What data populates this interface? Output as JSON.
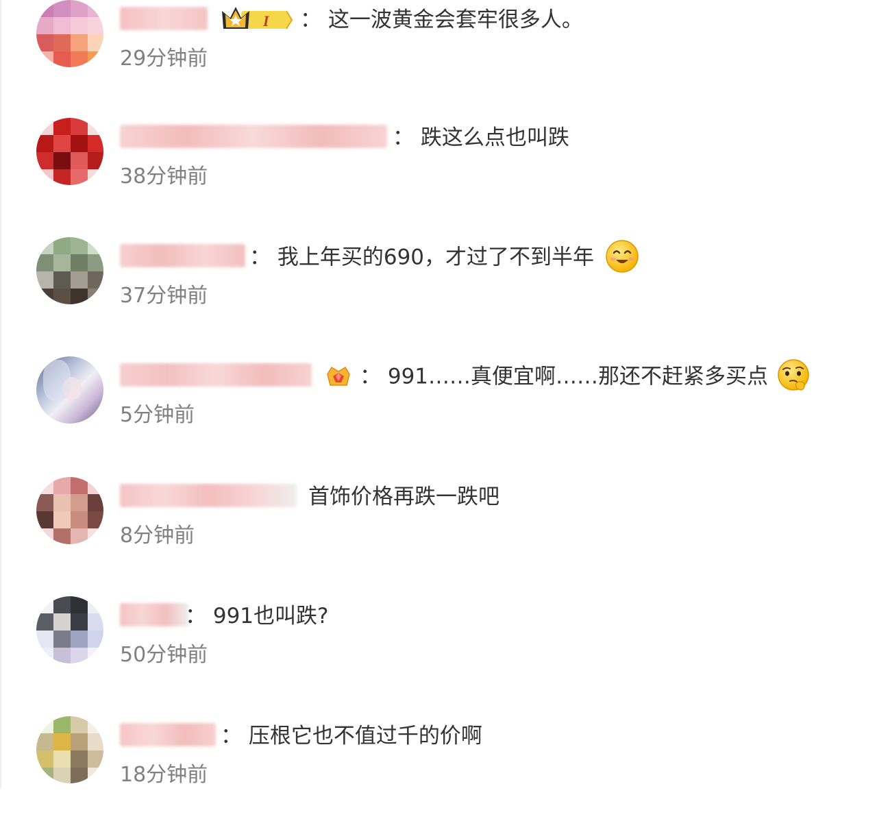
{
  "comments": [
    {
      "colon": "：",
      "text": "这一波黄金会套牢很多人。",
      "time": "29分钟前",
      "badge": "crown-level-badge",
      "badge_level": "I"
    },
    {
      "colon": "：",
      "text": "跌这么点也叫跌",
      "time": "38分钟前"
    },
    {
      "colon": "：",
      "text": "我上年买的690，才过了不到半年",
      "time": "37分钟前",
      "emoji": "smile-emoji-icon"
    },
    {
      "colon": "：",
      "text": "991……真便宜啊……那还不赶紧多买点",
      "time": "5分钟前",
      "badge": "gem-crown-badge",
      "emoji": "thinking-emoji-icon"
    },
    {
      "colon": "",
      "text": "首饰价格再跌一跌吧",
      "time": "8分钟前"
    },
    {
      "colon": "：",
      "text": "991也叫跌?",
      "time": "50分钟前"
    },
    {
      "colon": "：",
      "text": "压根它也不值过千的价啊",
      "time": "18分钟前"
    }
  ],
  "colors": {
    "text": "#333333",
    "time": "#808080",
    "name_blur": "#f7c6c6",
    "badge_gold": "#f5a623"
  }
}
